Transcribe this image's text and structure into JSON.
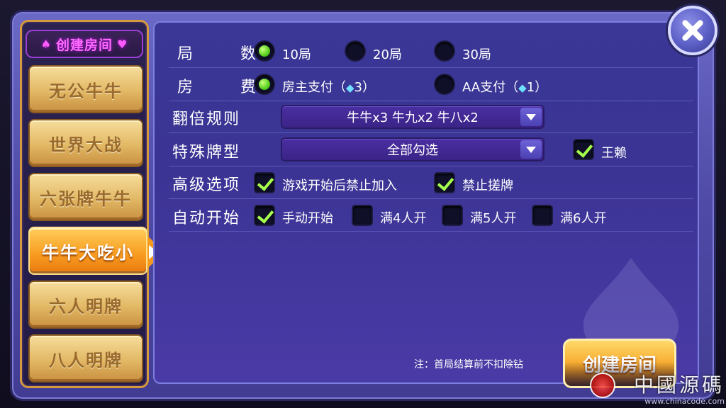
{
  "left": {
    "title": "创建房间",
    "modes": [
      "无公牛牛",
      "世界大战",
      "六张牌牛牛",
      "牛牛大吃小",
      "六人明牌",
      "八人明牌"
    ],
    "active_index": 3
  },
  "rounds": {
    "label": "局 数",
    "options": [
      "10局",
      "20局",
      "30局"
    ],
    "selected": "10局"
  },
  "fee": {
    "label": "房 费",
    "options": [
      {
        "text": "房主支付",
        "gem": "3"
      },
      {
        "text": "AA支付",
        "gem": "1"
      }
    ],
    "selected": "房主支付"
  },
  "double_rule": {
    "label": "翻倍规则",
    "value": "牛牛x3 牛九x2 牛八x2"
  },
  "special": {
    "label": "特殊牌型",
    "value": "全部勾选",
    "extra_label": "王赖",
    "extra_checked": true
  },
  "advanced": {
    "label": "高级选项",
    "options": [
      {
        "text": "游戏开始后禁止加入",
        "checked": true
      },
      {
        "text": "禁止搓牌",
        "checked": true
      }
    ]
  },
  "auto_start": {
    "label": "自动开始",
    "options": [
      {
        "text": "手动开始",
        "checked": true
      },
      {
        "text": "满4人开",
        "checked": false
      },
      {
        "text": "满5人开",
        "checked": false
      },
      {
        "text": "满6人开",
        "checked": false
      }
    ]
  },
  "note": "注：首局结算前不扣除钻",
  "create_button": "创建房间",
  "watermark": {
    "text": "中國源碼",
    "sub": "www.chinacode.com"
  },
  "colors": {
    "accent": "#f59a1e",
    "panel": "#3a3796",
    "check": "#a6ff4d"
  }
}
